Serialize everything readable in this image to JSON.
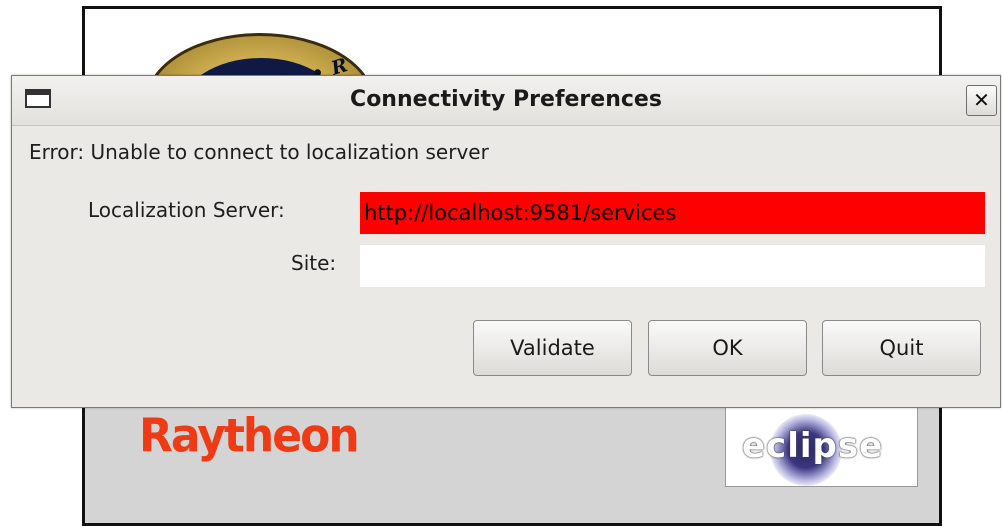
{
  "splash": {
    "seal_text": "Partnership • R",
    "brand_left": "Raytheon",
    "brand_right": "eclipse"
  },
  "dialog": {
    "title": "Connectivity Preferences",
    "close_glyph": "✕",
    "error_text": "Error: Unable to connect to localization server",
    "server_label": "Localization Server:",
    "server_value": "http://localhost:9581/services",
    "site_label": "Site:",
    "site_value": "",
    "buttons": {
      "validate": "Validate",
      "ok": "OK",
      "quit": "Quit"
    }
  },
  "colors": {
    "error_field_bg": "#ff0000",
    "dialog_bg": "#ebe9e6",
    "raytheon_red": "#ee3b16"
  }
}
